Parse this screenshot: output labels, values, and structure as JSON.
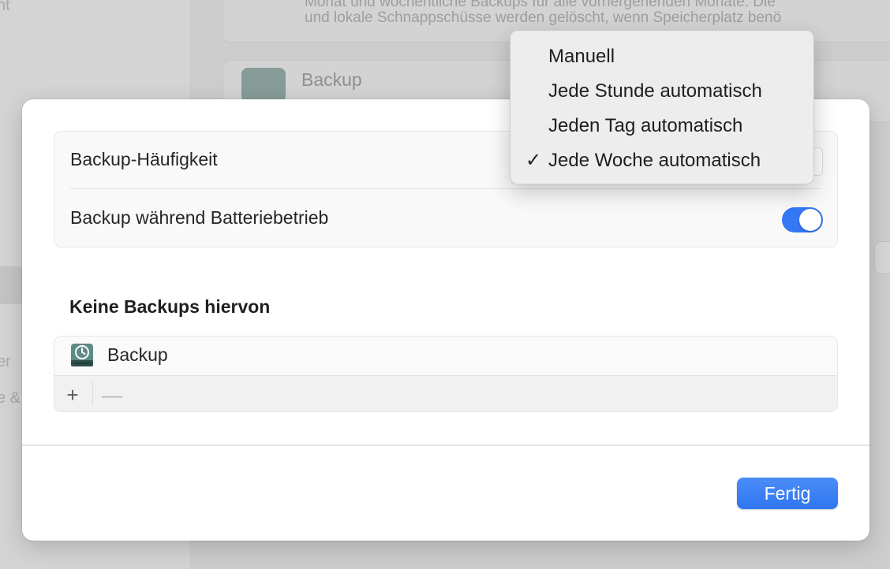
{
  "background": {
    "sidebar_fragments": [
      "nt",
      "er",
      "e &"
    ],
    "description_lines": [
      "Monat und wöchentliche Backups für alle vorhergehenden Monate. Die",
      "und lokale Schnappschüsse werden gelöscht, wenn Speicherplatz benö"
    ],
    "disk_label": "Backup"
  },
  "sheet": {
    "settings": {
      "frequency_label": "Backup-Häufigkeit",
      "battery_label": "Backup während Batteriebetrieb",
      "battery_toggle_on": true
    },
    "exclusions": {
      "title": "Keine Backups hiervon",
      "items": [
        {
          "label": "Backup",
          "icon": "time-machine-disk-icon"
        }
      ],
      "add_label": "+",
      "remove_label": "—"
    },
    "done_label": "Fertig"
  },
  "frequency_menu": {
    "items": [
      {
        "label": "Manuell",
        "checked": false
      },
      {
        "label": "Jede Stunde automatisch",
        "checked": false
      },
      {
        "label": "Jeden Tag automatisch",
        "checked": false
      },
      {
        "label": "Jede Woche automatisch",
        "checked": true
      }
    ],
    "check_glyph": "✓"
  },
  "colors": {
    "accent": "#3478f6",
    "toggle_on": "#3478f6"
  }
}
